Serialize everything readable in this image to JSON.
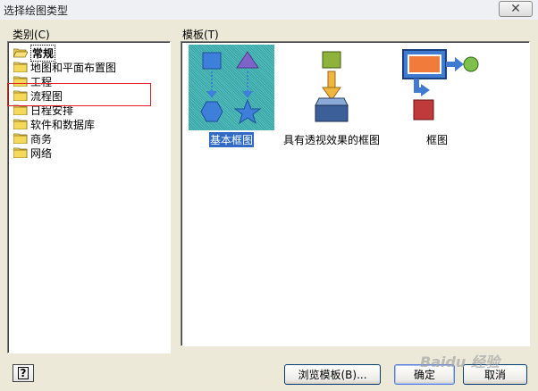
{
  "window": {
    "title": "选择绘图类型",
    "close_symbol": "✕"
  },
  "categories": {
    "label": "类别(C)",
    "items": [
      {
        "label": "常规",
        "selected": true
      },
      {
        "label": "地图和平面布置图"
      },
      {
        "label": "工程"
      },
      {
        "label": "流程图"
      },
      {
        "label": "日程安排"
      },
      {
        "label": "软件和数据库"
      },
      {
        "label": "商务"
      },
      {
        "label": "网络"
      }
    ]
  },
  "templates": {
    "label": "模板(T)",
    "items": [
      {
        "label": "基本框图",
        "selected": true
      },
      {
        "label": "具有透视效果的框图"
      },
      {
        "label": "框图"
      }
    ]
  },
  "footer": {
    "help_label": "?",
    "browse_label": "浏览模板(B)...",
    "ok_label": "确定",
    "cancel_label": "取消"
  },
  "watermark": "Baidu 经验",
  "colors": {
    "highlight_box": "#e02020",
    "selection": "#316ac5"
  }
}
